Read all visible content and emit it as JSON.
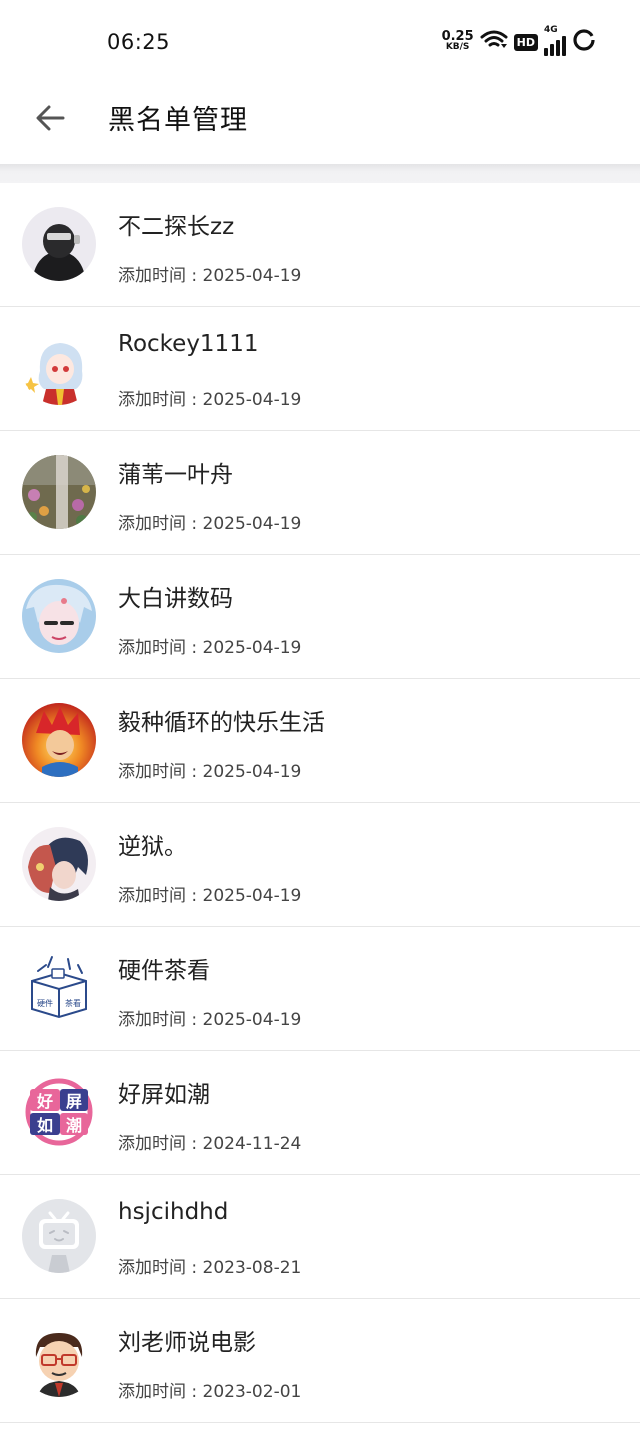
{
  "status_bar": {
    "time": "06:25",
    "net_speed_value": "0.25",
    "net_speed_unit": "KB/S",
    "hd_badge": "HD",
    "network_type": "4G",
    "icons": [
      "wifi-icon",
      "hd-badge",
      "signal-4g-icon",
      "battery-ring-icon"
    ]
  },
  "header": {
    "title": "黑名单管理",
    "back_icon": "arrow-left-icon"
  },
  "blacklist": [
    {
      "name": "不二探长zz",
      "added": "添加时间 : 2025-04-19",
      "avatar_icon": "avatar-helmet-figure"
    },
    {
      "name": "Rockey1111",
      "added": "添加时间 : 2025-04-19",
      "avatar_icon": "avatar-anime-girl"
    },
    {
      "name": "蒲苇一叶舟",
      "added": "添加时间 : 2025-04-19",
      "avatar_icon": "avatar-flowers-photo"
    },
    {
      "name": "大白讲数码",
      "added": "添加时间 : 2025-04-19",
      "avatar_icon": "avatar-anime-face"
    },
    {
      "name": "毅种循环的快乐生活",
      "added": "添加时间 : 2025-04-19",
      "avatar_icon": "avatar-fire-hero"
    },
    {
      "name": "逆狱。",
      "added": "添加时间 : 2025-04-19",
      "avatar_icon": "avatar-anime-boy"
    },
    {
      "name": "硬件茶看",
      "added": "添加时间 : 2025-04-19",
      "avatar_icon": "avatar-box-logo",
      "logo_text": [
        "硬件",
        "茶看"
      ]
    },
    {
      "name": "好屏如潮",
      "added": "添加时间 : 2024-11-24",
      "avatar_icon": "avatar-text-logo",
      "logo_text": [
        "好",
        "屏",
        "如",
        "潮"
      ]
    },
    {
      "name": "hsjcihdhd",
      "added": "添加时间 : 2023-08-21",
      "avatar_icon": "avatar-default-tv"
    },
    {
      "name": "刘老师说电影",
      "added": "添加时间 : 2023-02-01",
      "avatar_icon": "avatar-cartoon-man"
    }
  ]
}
